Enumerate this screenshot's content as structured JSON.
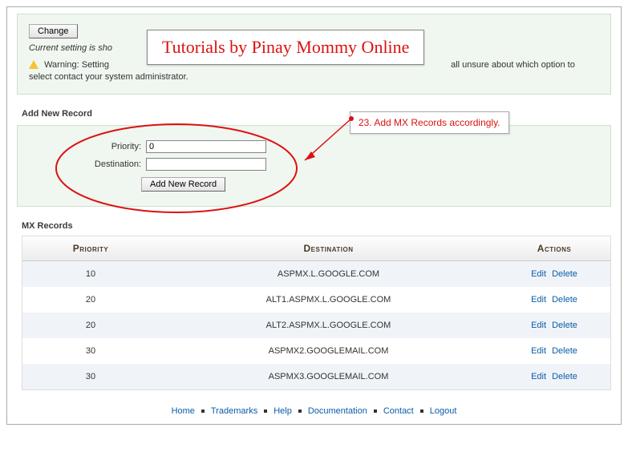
{
  "topPanel": {
    "changeButton": "Change",
    "currentSetting": "Current setting is sho",
    "warningLabel": "Warning:",
    "warningPrefix": " Setting ",
    "warningSuffix": "all unsure about which option to select contact your system administrator."
  },
  "addRecord": {
    "title": "Add New Record",
    "priorityLabel": "Priority:",
    "destinationLabel": "Destination:",
    "priorityValue": "0",
    "destinationValue": "",
    "addButton": "Add New Record"
  },
  "mx": {
    "title": "MX Records",
    "headers": {
      "priority": "Priority",
      "destination": "Destination",
      "actions": "Actions"
    },
    "editLabel": "Edit",
    "deleteLabel": "Delete",
    "rows": [
      {
        "priority": "10",
        "destination": "ASPMX.L.GOOGLE.COM"
      },
      {
        "priority": "20",
        "destination": "ALT1.ASPMX.L.GOOGLE.COM"
      },
      {
        "priority": "20",
        "destination": "ALT2.ASPMX.L.GOOGLE.COM"
      },
      {
        "priority": "30",
        "destination": "ASPMX2.GOOGLEMAIL.COM"
      },
      {
        "priority": "30",
        "destination": "ASPMX3.GOOGLEMAIL.COM"
      }
    ]
  },
  "footer": {
    "links": [
      "Home",
      "Trademarks",
      "Help",
      "Documentation",
      "Contact",
      "Logout"
    ]
  },
  "annotations": {
    "tutorialBanner": "Tutorials by Pinay Mommy Online",
    "callout": "23. Add MX Records accordingly."
  }
}
